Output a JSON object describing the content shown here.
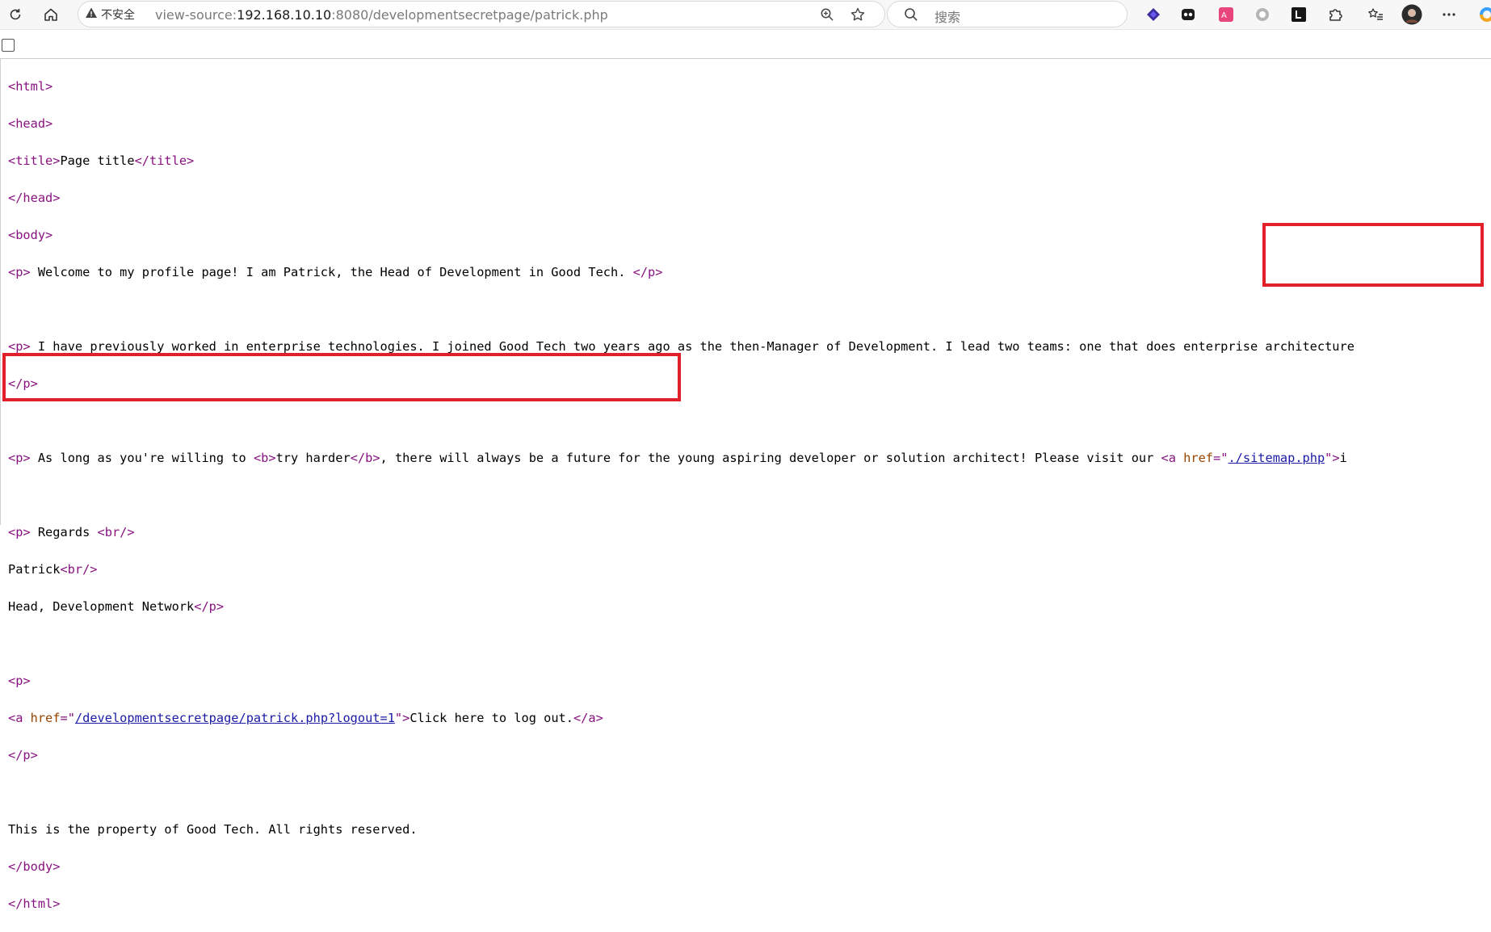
{
  "browser": {
    "security_label": "不安全",
    "url_prefix": "view-source:",
    "url_host": "192.168.10.10",
    "url_rest": ":8080/developmentsecretpage/patrick.php",
    "search_placeholder": "搜索"
  },
  "source": {
    "l1_open": "<html>",
    "l2_open": "<head>",
    "l3_title_open": "<title>",
    "l3_title_text": "Page title",
    "l3_title_close": "</title>",
    "l4_close": "</head>",
    "l5_open": "<body>",
    "l6_p_open": "<p>",
    "l6_text": " Welcome to my profile page! I am Patrick, the Head of Development in Good Tech. ",
    "l6_p_close": "</p>",
    "l8_p_open": "<p>",
    "l8_text": " I have previously worked in enterprise technologies. I joined Good Tech two years ago as the then-Manager of Development. I lead two teams: one that does enterprise architecture",
    "l9_p_close": "</p>",
    "l11_p_open": "<p>",
    "l11_text1": " As long as you're willing to ",
    "l11_b_open": "<b>",
    "l11_b_text": "try harder",
    "l11_b_close": "</b>",
    "l11_text2": ", there will always be a future for the young aspiring developer or solution architect! Please visit our ",
    "l11_a_open": "<a ",
    "l11_a_attr": "href",
    "l11_a_eq": "=\"",
    "l11_a_link": "./sitemap.php",
    "l11_a_end": "\">",
    "l11_trail": "i",
    "l13_p_open": "<p>",
    "l13_text": " Regards ",
    "l13_br": "<br/>",
    "l14_text": "Patrick",
    "l14_br": "<br/>",
    "l15_text": "Head, Development Network",
    "l15_p_close": "</p>",
    "l17_p_open": "<p>",
    "l18_a_open": "<a ",
    "l18_a_attr": "href",
    "l18_a_eq": "=\"",
    "l18_a_link": "/developmentsecretpage/patrick.php?logout=1",
    "l18_a_end": "\">",
    "l18_text": "Click here to log out.",
    "l18_a_close": "</a>",
    "l19_p_close": "</p>",
    "l21_text": "This is the property of Good Tech. All rights reserved.",
    "l22_close": "</body>",
    "l23_close": "</html>"
  },
  "colors": {
    "tag": "#881280",
    "attribute": "#994500",
    "link": "#1a1aa6",
    "highlight_box": "#e3202a"
  }
}
